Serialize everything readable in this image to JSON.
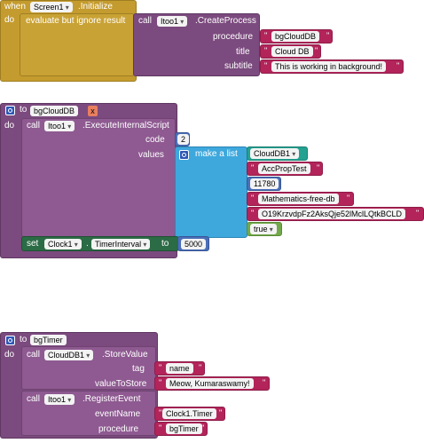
{
  "block1": {
    "when_kw": "when",
    "component": "Screen1",
    "event": ".Initialize",
    "do_kw": "do",
    "evaluate_label": "evaluate but ignore result",
    "call_kw": "call",
    "target": "Itoo1",
    "method": ".CreateProcess",
    "params": [
      {
        "label": "procedure",
        "value": "bgCloudDB"
      },
      {
        "label": "title",
        "value": "Cloud DB"
      },
      {
        "label": "subtitle",
        "value": "This is working in background!"
      }
    ]
  },
  "block2": {
    "to_kw": "to",
    "proc_name": "bgCloudDB",
    "x_label": "x",
    "do_kw": "do",
    "call_kw": "call",
    "target": "Itoo1",
    "method": ".ExecuteInternalScript",
    "code_label": "code",
    "code_value": "2",
    "values_label": "values",
    "make_list_label": "make a list",
    "list_items": {
      "component": "CloudDB1",
      "project": "AccPropTest",
      "port": "11780",
      "server": "Mathematics-free-db",
      "token": "O19KrzvdpFz2AksQje52lMclLQtkBCLD",
      "bool": "true"
    },
    "set_kw": "set",
    "set_component": "Clock1",
    "set_prop": "TimerInterval",
    "to2_kw": "to",
    "set_value": "5000"
  },
  "block3": {
    "to_kw": "to",
    "proc_name": "bgTimer",
    "do_kw": "do",
    "call_kw": "call",
    "target1": "CloudDB1",
    "method1": ".StoreValue",
    "tag_label": "tag",
    "tag_value": "name",
    "vts_label": "valueToStore",
    "vts_value": "Meow, Kumaraswamy!",
    "target2": "Itoo1",
    "method2": ".RegisterEvent",
    "event_label": "eventName",
    "event_value": "Clock1.Timer",
    "proc_label": "procedure",
    "proc_value": "bgTimer"
  }
}
